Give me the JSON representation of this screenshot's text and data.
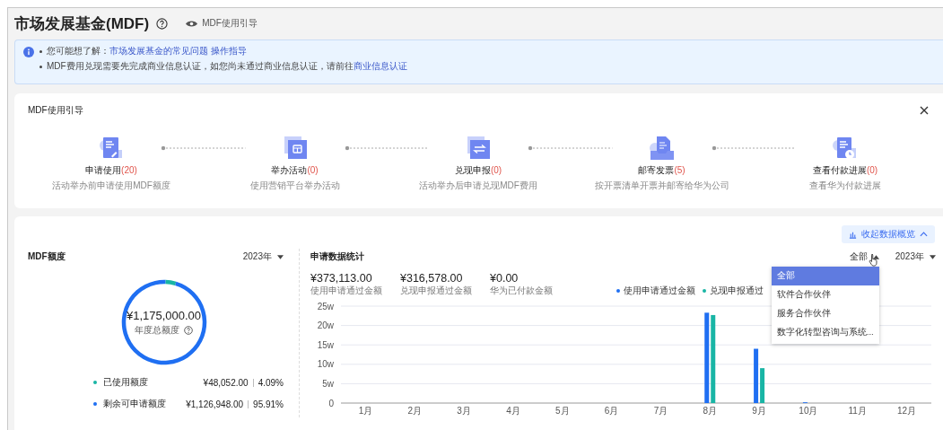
{
  "header": {
    "title": "市场发展基金(MDF)",
    "guide_link": "MDF使用引导"
  },
  "notice": {
    "lines": [
      {
        "text": "您可能想了解：",
        "links": [
          "市场发展基金的常见问题",
          "操作指导"
        ]
      },
      {
        "text": "MDF费用兑现需要先完成商业信息认证，如您尚未通过商业信息认证，请前往",
        "links": [
          "商业信息认证"
        ]
      }
    ]
  },
  "guide": {
    "title": "MDF使用引导",
    "steps": [
      {
        "kind": "apply",
        "title": "申请使用",
        "count": "(20)",
        "desc": "活动举办前申请使用MDF额度"
      },
      {
        "kind": "activity",
        "title": "举办活动",
        "count": "(0)",
        "desc": "使用营销平台举办活动"
      },
      {
        "kind": "redeem",
        "title": "兑现申报",
        "count": "(0)",
        "desc": "活动举办后申请兑现MDF费用"
      },
      {
        "kind": "mail",
        "title": "邮寄发票",
        "count": "(5)",
        "desc": "按开票清单开票并邮寄给华为公司"
      },
      {
        "kind": "payment",
        "title": "查看付款进展",
        "count": "(0)",
        "desc": "查看华为付款进展"
      }
    ]
  },
  "collapse_button": "收起数据概览",
  "quota": {
    "title": "MDF额度",
    "year": "2023年",
    "total": "¥1,175,000.00",
    "total_label": "年度总额度",
    "chart_data": {
      "type": "donut",
      "values": [
        4.09,
        95.91
      ]
    },
    "legend": [
      {
        "label": "已使用额度",
        "amount": "¥48,052.00",
        "percent": "4.09%",
        "color": "#19b5a5"
      },
      {
        "label": "剩余可申请额度",
        "amount": "¥1,126,948.00",
        "percent": "95.91%",
        "color": "#1f6ff2"
      }
    ]
  },
  "stats": {
    "title": "申请数据统计",
    "filter": "全部",
    "year": "2023年",
    "figures": [
      {
        "value": "¥373,113.00",
        "label": "使用申请通过金额"
      },
      {
        "value": "¥316,578.00",
        "label": "兑现申报通过金额"
      },
      {
        "value": "¥0.00",
        "label": "华为已付款金额"
      }
    ],
    "chart_data": {
      "type": "bar",
      "categories": [
        "1月",
        "2月",
        "3月",
        "4月",
        "5月",
        "6月",
        "7月",
        "8月",
        "9月",
        "10月",
        "11月",
        "12月"
      ],
      "series": [
        {
          "name": "使用申请通过金额",
          "color": "#1f6ff2",
          "values": [
            0,
            0,
            0,
            0,
            0,
            0,
            0,
            23.3,
            14,
            0.2,
            0,
            0
          ]
        },
        {
          "name": "兑现申报通过",
          "color": "#19b5a5",
          "values": [
            0,
            0,
            0,
            0,
            0,
            0,
            0,
            22.7,
            9,
            0,
            0,
            0
          ]
        }
      ],
      "ylim": [
        0,
        25
      ],
      "grid": true,
      "yticks": [
        {
          "value": 0,
          "label": "0"
        },
        {
          "value": 5,
          "label": "5w"
        },
        {
          "value": 10,
          "label": "10w"
        },
        {
          "value": 15,
          "label": "15w"
        },
        {
          "value": 20,
          "label": "20w"
        },
        {
          "value": 25,
          "label": "25w"
        }
      ]
    },
    "dropdown": [
      {
        "label": "全部",
        "selected": true
      },
      {
        "label": "软件合作伙伴",
        "selected": false
      },
      {
        "label": "服务合作伙伴",
        "selected": false
      },
      {
        "label": "数字化转型咨询与系统...",
        "selected": false
      }
    ]
  }
}
